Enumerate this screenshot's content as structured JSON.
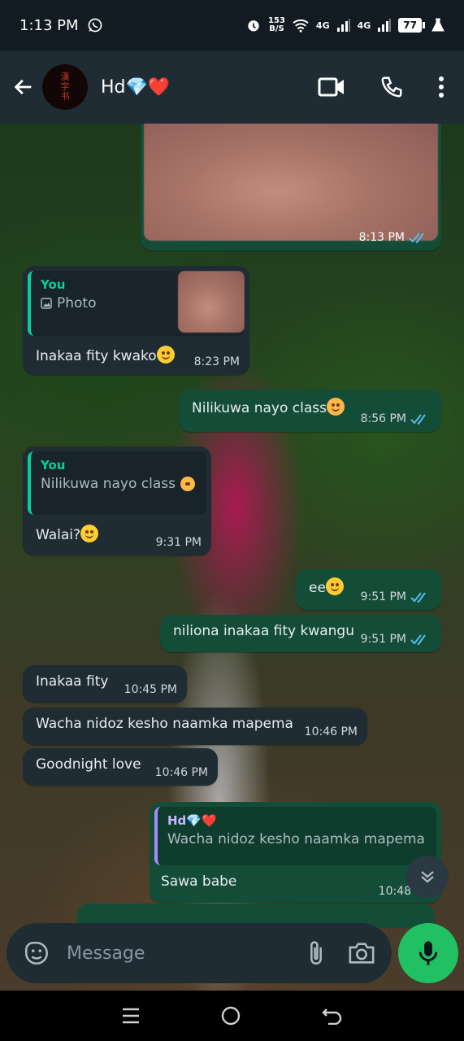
{
  "status_bar": {
    "time": "1:13 PM",
    "speed_value": "153",
    "speed_unit": "B/S",
    "network1": "4G",
    "network2": "4G",
    "battery": "77"
  },
  "header": {
    "contact_name": "Hd💎❤️"
  },
  "messages": [
    {
      "time": "8:13 PM"
    },
    {
      "quote_author": "You",
      "quote_text": "Photo",
      "text": "Inakaa fity kwako",
      "time": "8:23 PM"
    },
    {
      "text": "Nilikuwa nayo class",
      "time": "8:56 PM"
    },
    {
      "quote_author": "You",
      "quote_text": "Nilikuwa nayo class",
      "text": "Walai?",
      "time": "9:31 PM"
    },
    {
      "text": "ee",
      "time": "9:51 PM"
    },
    {
      "text": "niliona inakaa fity kwangu",
      "time": "9:51 PM"
    },
    {
      "text": "Inakaa fity",
      "time": "10:45 PM"
    },
    {
      "text": "Wacha nidoz kesho naamka mapema",
      "time": "10:46 PM"
    },
    {
      "text": "Goodnight love",
      "time": "10:46 PM"
    },
    {
      "quote_author": "Hd💎❤️",
      "quote_text": "Wacha nidoz kesho naamka mapema",
      "text": "Sawa babe",
      "time": "10:48 PM"
    }
  ],
  "composer": {
    "placeholder": "Message"
  },
  "colors": {
    "incoming_bubble": "#1f2c34",
    "outgoing_bubble": "#134d37",
    "read_ticks": "#53bdeb",
    "mic_button": "#21c063",
    "quote_you": "#06cf9c",
    "quote_contact": "#a78bfa"
  }
}
